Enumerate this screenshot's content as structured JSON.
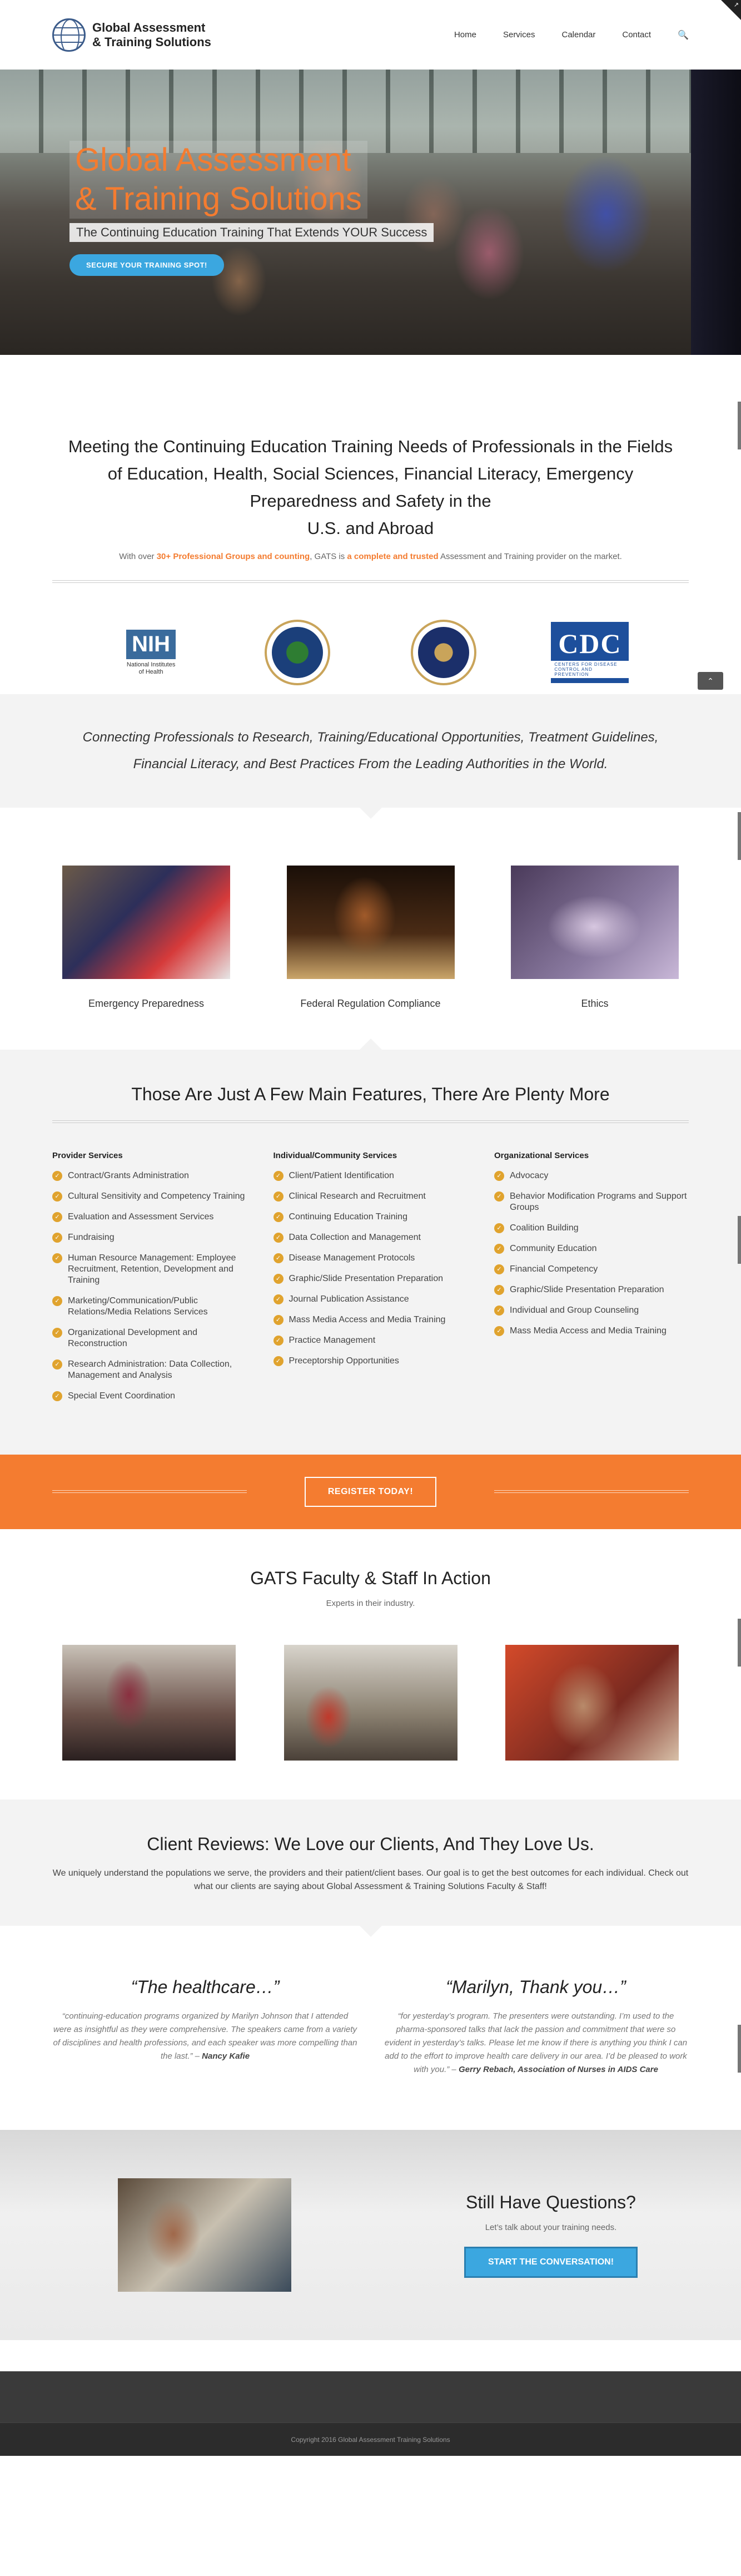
{
  "header": {
    "logo_line1": "Global Assessment",
    "logo_line2": "& Training Solutions",
    "nav": [
      "Home",
      "Services",
      "Calendar",
      "Contact"
    ],
    "search_icon": "search-icon"
  },
  "hero": {
    "title_line1": "Global Assessment",
    "title_line2": "& Training Solutions",
    "subtitle": "The Continuing Education Training That Extends YOUR Success",
    "button": "SECURE YOUR TRAINING SPOT!"
  },
  "intro": {
    "heading_line1": "Meeting the Continuing Education Training Needs of Professionals in the Fields",
    "heading_line2": "of Education, Health, Social Sciences, Financial Literacy, Emergency",
    "heading_line3": "Preparedness and Safety in the",
    "heading_line4": "U.S. and Abroad",
    "text_pre": "With over ",
    "text_hl1": "30+ Professional Groups and counting",
    "text_mid": ", GATS is ",
    "text_hl2": "a complete and trusted",
    "text_post": " Assessment and Training provider on the market."
  },
  "logos": {
    "nih_mark": "NIH",
    "nih_label_1": "National Institutes",
    "nih_label_2": "of Health",
    "cdc_mark": "CDC",
    "cdc_sub": "CENTERS FOR DISEASE CONTROL AND PREVENTION"
  },
  "band": {
    "line1": "Connecting Professionals to Research, Training/Educational Opportunities, Treatment Guidelines,",
    "line2": "Financial Literacy, and Best Practices From the Leading Authorities in the World."
  },
  "focus": [
    "Emergency Preparedness",
    "Federal Regulation Compliance",
    "Ethics"
  ],
  "features": {
    "title": "Those Are Just A Few Main Features, There Are Plenty More",
    "columns": [
      {
        "heading": "Provider Services",
        "items": [
          "Contract/Grants Administration",
          "Cultural Sensitivity and Competency Training",
          "Evaluation and Assessment Services",
          "Fundraising",
          "Human Resource Management: Employee Recruitment, Retention, Development and Training",
          "Marketing/Communication/Public Relations/Media Relations Services",
          "Organizational Development and Reconstruction",
          "Research Administration: Data Collection, Management and Analysis",
          "Special Event Coordination"
        ]
      },
      {
        "heading": "Individual/Community Services",
        "items": [
          "Client/Patient Identification",
          "Clinical Research and Recruitment",
          "Continuing Education Training",
          "Data Collection and Management",
          "Disease Management Protocols",
          "Graphic/Slide Presentation Preparation",
          "Journal Publication Assistance",
          "Mass Media Access and Media Training",
          "Practice Management",
          "Preceptorship Opportunities"
        ]
      },
      {
        "heading": "Organizational Services",
        "items": [
          "Advocacy",
          "Behavior Modification Programs and Support Groups",
          "Coalition Building",
          "Community Education",
          "Financial Competency",
          "Graphic/Slide Presentation Preparation",
          "Individual and Group Counseling",
          "Mass Media Access and Media Training"
        ]
      }
    ]
  },
  "cta": {
    "button": "REGISTER TODAY!"
  },
  "team": {
    "title": "GATS Faculty & Staff In Action",
    "subtitle": "Experts in their industry."
  },
  "reviews": {
    "title": "Client Reviews: We Love our Clients, And They Love Us.",
    "text": "We uniquely understand the populations we serve, the providers and their patient/client bases. Our goal is to get the best outcomes for each individual. Check out what our clients are saying about Global Assessment & Training Solutions Faculty & Staff!",
    "items": [
      {
        "heading": "“The healthcare…”",
        "quote": "“continuing-education programs organized by Marilyn Johnson that I attended were as insightful as they were comprehensive. The speakers came from a variety of disciplines and health professions, and each speaker was more compelling than the last.” –",
        "author": "Nancy Kafie"
      },
      {
        "heading": "“Marilyn, Thank you…”",
        "quote": "“for yesterday’s program. The presenters were outstanding. I’m used to the pharma-sponsored talks that lack the passion and commitment that were so evident in yesterday’s talks. Please let me know if there is anything you think I can add to the effort to improve health care delivery in our area. I’d be pleased to work with you.” –",
        "author": "Gerry Rebach, Association of Nurses in AIDS Care"
      }
    ]
  },
  "questions": {
    "title": "Still Have Questions?",
    "subtitle": "Let’s talk about your training needs.",
    "button": "START THE CONVERSATION!"
  },
  "footer": {
    "copyright": "Copyright 2016 Global Assessment Training Solutions"
  },
  "colors": {
    "accent": "#f47c30",
    "button_blue": "#3ba7e0",
    "check": "#e0a32e"
  }
}
